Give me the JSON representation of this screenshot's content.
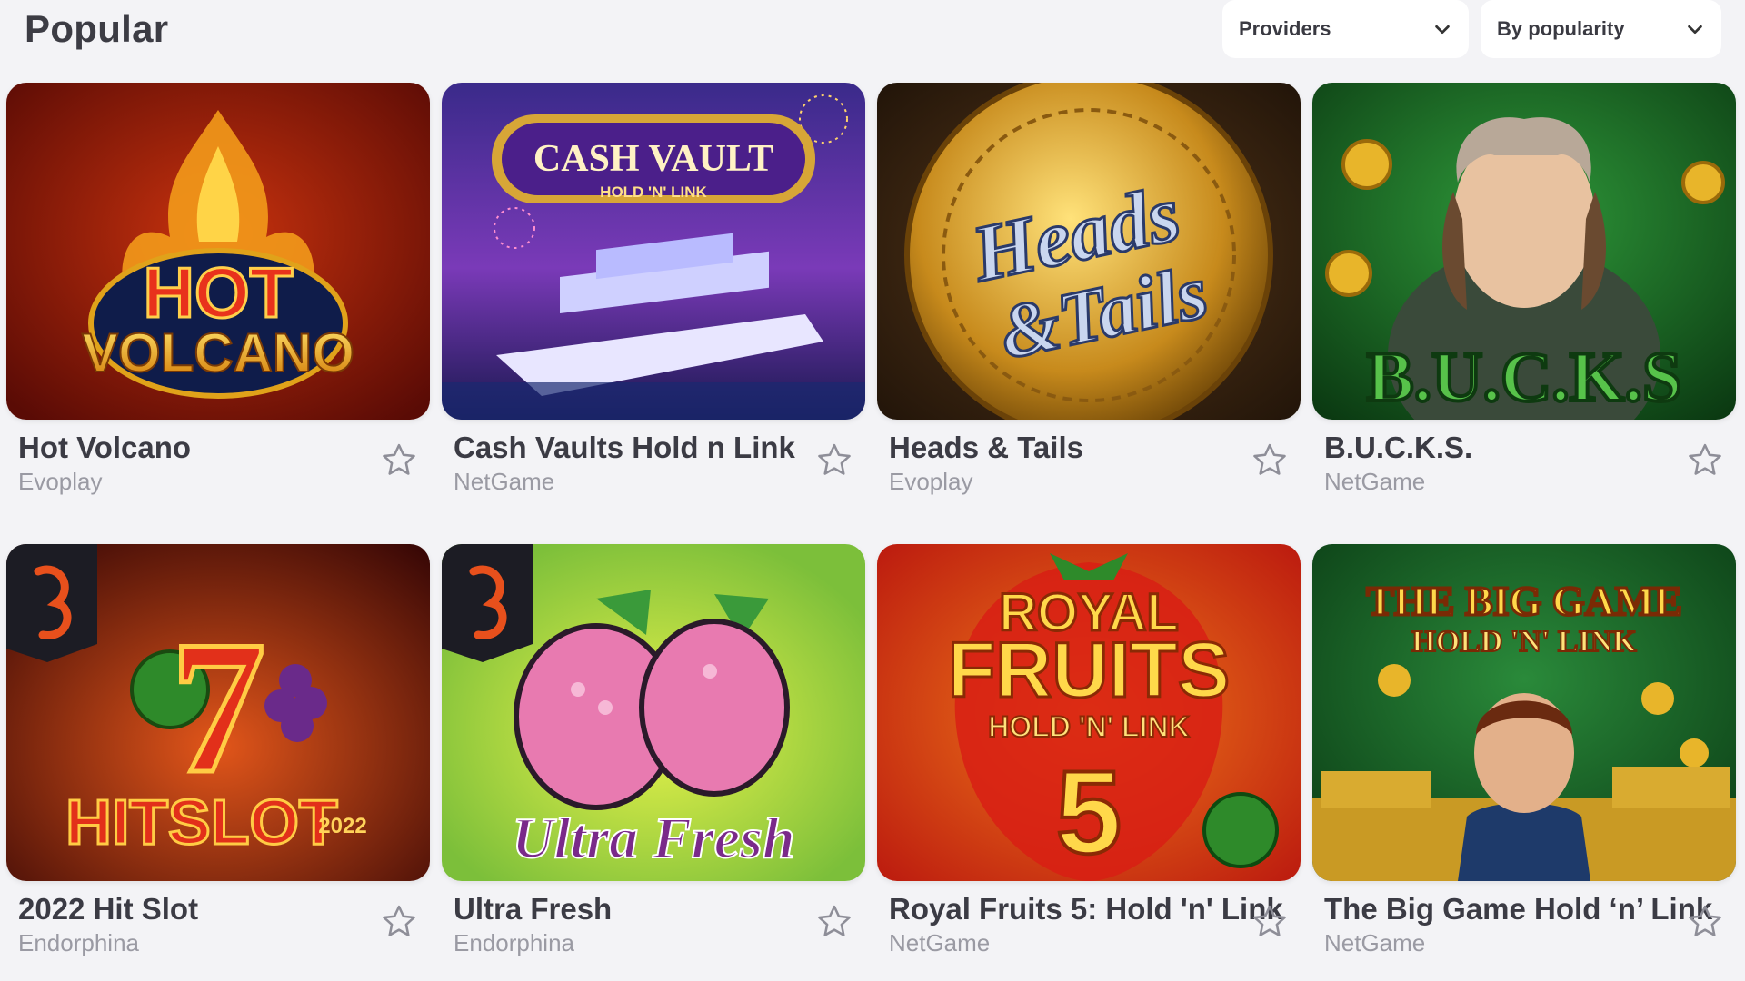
{
  "section": {
    "title": "Popular"
  },
  "filters": {
    "providers_label": "Providers",
    "sort_label": "By popularity"
  },
  "games": [
    {
      "title": "Hot Volcano",
      "provider": "Evoplay",
      "art_text": [
        "HOT",
        "VOLCANO"
      ]
    },
    {
      "title": "Cash Vaults Hold n Link",
      "provider": "NetGame",
      "art_text": [
        "CASH VAULT",
        "HOLD 'N' LINK"
      ]
    },
    {
      "title": "Heads & Tails",
      "provider": "Evoplay",
      "art_text": [
        "Heads",
        "&Tails"
      ]
    },
    {
      "title": "B.U.C.K.S.",
      "provider": "NetGame",
      "art_text": [
        "B.U.C.K.S"
      ]
    },
    {
      "title": "2022 Hit Slot",
      "provider": "Endorphina",
      "art_text": [
        "7",
        "HITSLOT",
        "2022"
      ]
    },
    {
      "title": "Ultra Fresh",
      "provider": "Endorphina",
      "art_text": [
        "Ultra Fresh"
      ]
    },
    {
      "title": "Royal Fruits 5: Hold 'n' Link",
      "provider": "NetGame",
      "art_text": [
        "ROYAL",
        "FRUITS",
        "HOLD 'N' LINK",
        "5"
      ]
    },
    {
      "title": "The Big Game Hold ‘n’ Link",
      "provider": "NetGame",
      "art_text": [
        "THE BIG GAME",
        "HOLD 'N' LINK"
      ]
    }
  ],
  "icons": {
    "dropdown": "chevron-down-icon",
    "favorite": "star-outline-icon"
  },
  "colors": {
    "background": "#f3f3f6",
    "title_text": "#3b3b44",
    "provider_text": "#9a9aa3",
    "star_outline": "#8e8e98"
  }
}
